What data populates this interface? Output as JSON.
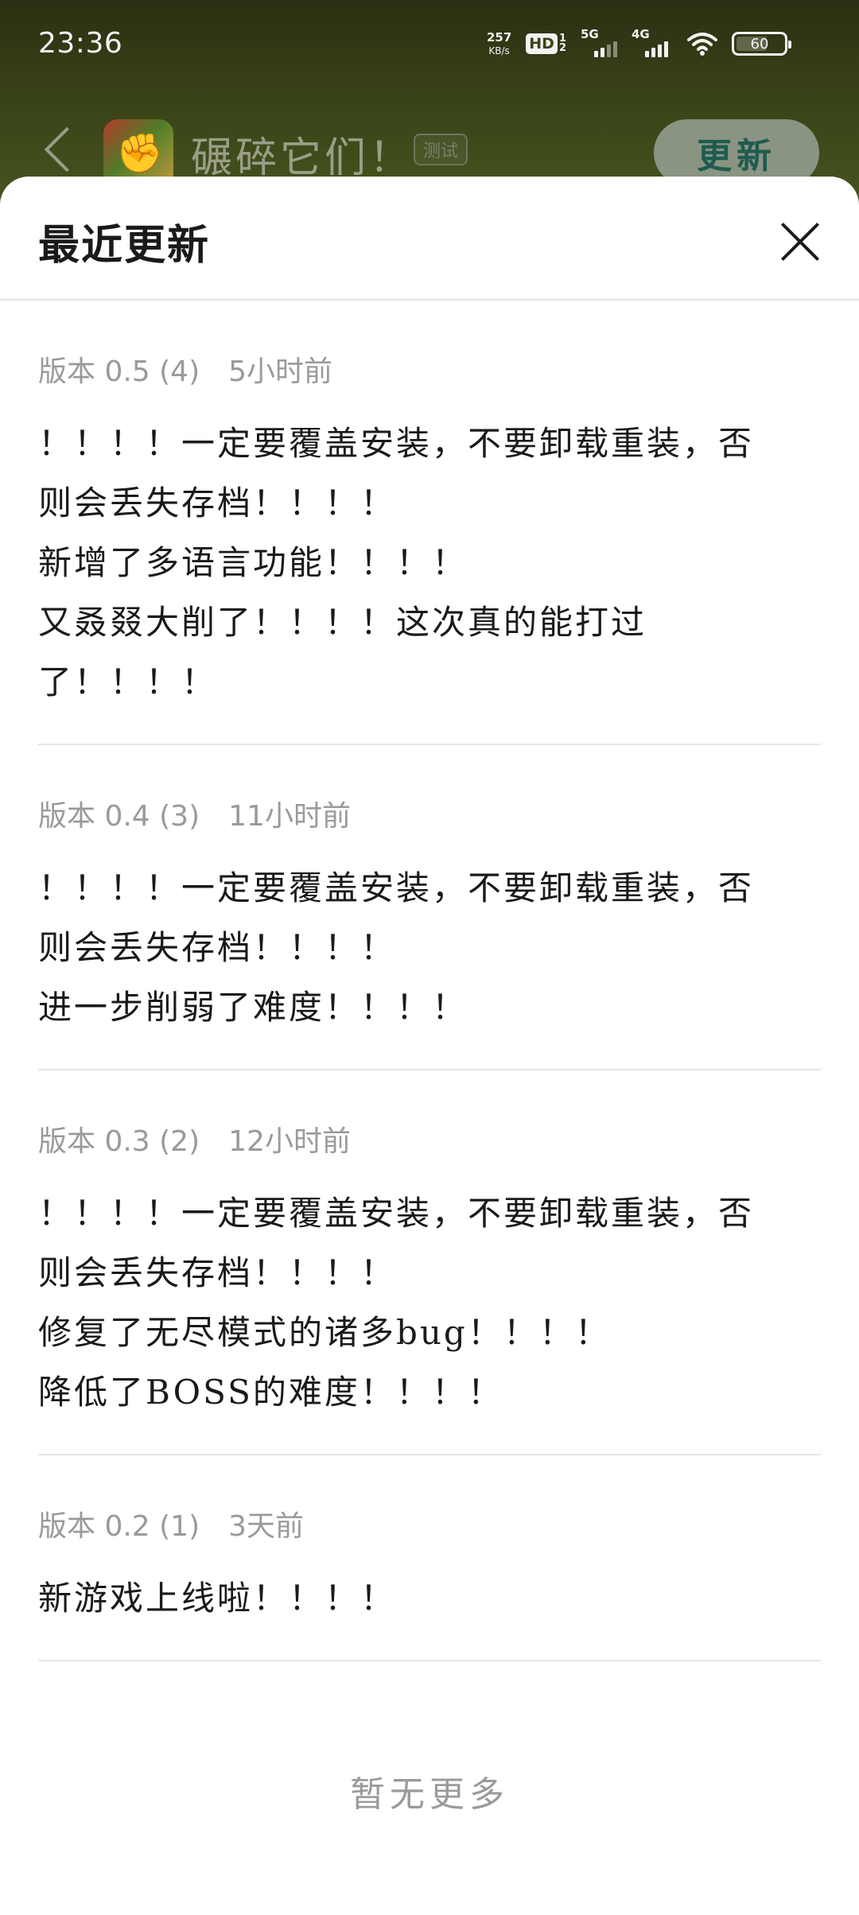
{
  "status": {
    "time": "23:36",
    "net_speed": "257",
    "net_unit": "KB/s",
    "hd_label": "HD",
    "hd_sub_top": "1",
    "hd_sub_bottom": "2",
    "sig1_label": "5G",
    "sig2_label": "4G",
    "battery": "60"
  },
  "header": {
    "app_title": "碾碎它们！",
    "tag": "测试",
    "update_label": "更新"
  },
  "sheet": {
    "title": "最近更新",
    "releases": [
      {
        "version": "版本 0.5 (4)",
        "time": "5小时前",
        "lines": [
          "！！！！一定要覆盖安装，不要卸载重装，否",
          "则会丢失存档！！！！",
          "新增了多语言功能！！！！",
          "又叒叕大削了！！！！这次真的能打过",
          "了！！！！"
        ]
      },
      {
        "version": "版本 0.4 (3)",
        "time": "11小时前",
        "lines": [
          "！！！！一定要覆盖安装，不要卸载重装，否",
          "则会丢失存档！！！！",
          "进一步削弱了难度！！！！"
        ]
      },
      {
        "version": "版本 0.3 (2)",
        "time": "12小时前",
        "lines": [
          "！！！！一定要覆盖安装，不要卸载重装，否",
          "则会丢失存档！！！！",
          "修复了无尽模式的诸多bug！！！！",
          "降低了BOSS的难度！！！！"
        ]
      },
      {
        "version": "版本 0.2 (1)",
        "time": "3天前",
        "lines": [
          "新游戏上线啦！！！！"
        ]
      }
    ],
    "no_more": "暂无更多"
  }
}
